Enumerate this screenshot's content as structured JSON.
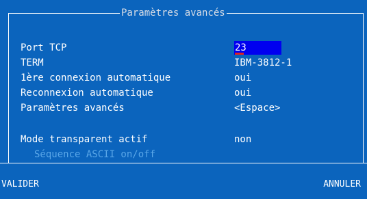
{
  "dialog": {
    "title": "Paramètres avancés"
  },
  "fields": {
    "port_tcp": {
      "label": "Port TCP",
      "value": "23"
    },
    "term": {
      "label": "TERM",
      "value": "IBM-3812-1"
    },
    "first_connection": {
      "label": "1ère connexion automatique",
      "value": "oui"
    },
    "reconnection": {
      "label": "Reconnexion automatique",
      "value": "oui"
    },
    "advanced": {
      "label": "Paramètres avancés",
      "value": "<Espace>"
    },
    "transparent_mode": {
      "label": "Mode transparent actif",
      "value": "non"
    },
    "ascii_sequence": {
      "label": "Séquence ASCII on/off"
    }
  },
  "buttons": {
    "validate": "VALIDER",
    "cancel": "ANNULER"
  },
  "colors": {
    "background": "#0b64bd",
    "input_focus": "#0000f0",
    "cursor": "#e02020",
    "disabled_text": "#5aa7e8"
  }
}
